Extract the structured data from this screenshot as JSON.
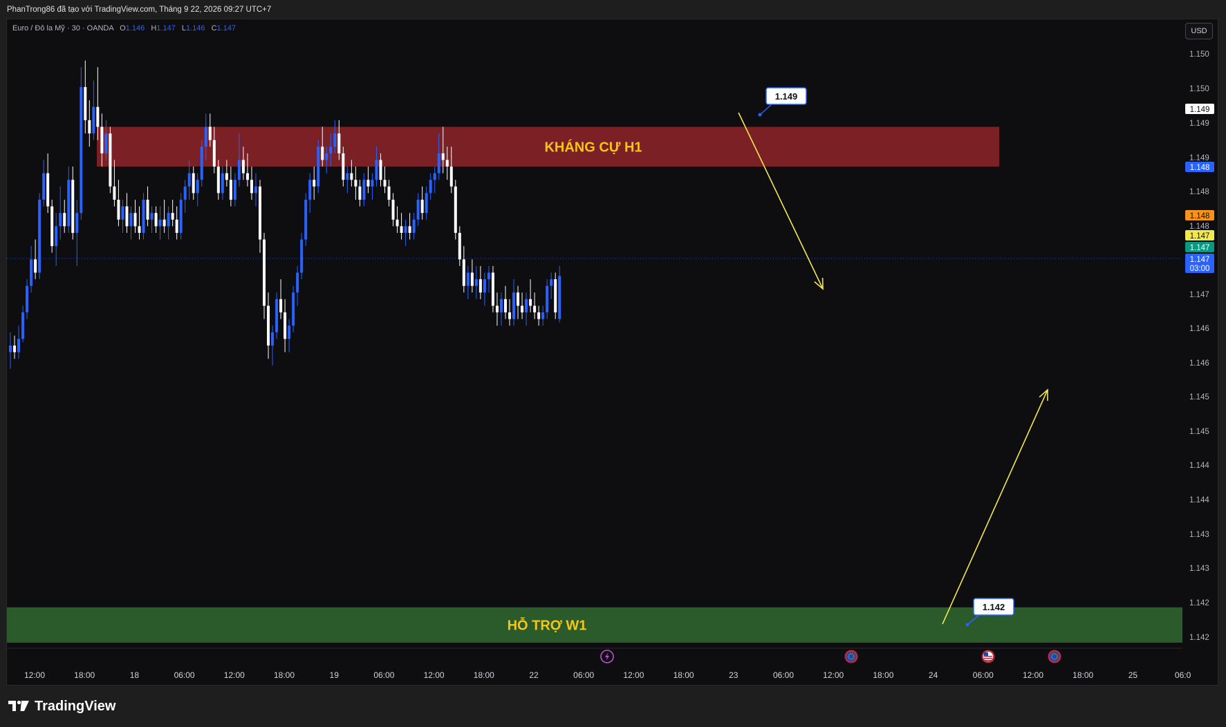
{
  "header": {
    "attribution": "PhanTrong86 đã tạo với TradingView.com, Tháng 9 22, 2026 09:27 UTC+7"
  },
  "legend": {
    "symbol": "Euro / Đô la Mỹ · 30 · OANDA",
    "open_label": "O",
    "open": "1.146",
    "high_label": "H",
    "high": "1.147",
    "low_label": "L",
    "low": "1.146",
    "close_label": "C",
    "close": "1.147"
  },
  "currency_button": "USD",
  "brand": {
    "name": "TradingView",
    "icon": "tradingview-logo-icon"
  },
  "colors": {
    "background": "#0e0e10",
    "bull_candle": "#2962ff",
    "bear_candle": "#ffffff",
    "resistance_zone": "#7b2126",
    "support_zone": "#2b5b2b",
    "zone_text": "#f5c518",
    "arrow": "#f2e94e",
    "current_price": "#2962ff"
  },
  "chart_data": {
    "type": "candlestick",
    "symbol": "EURUSD",
    "timeframe": "30",
    "y_ticks": [
      "1.150",
      "1.150",
      "1.149",
      "1.149",
      "1.148",
      "1.148",
      "1.147",
      "1.147",
      "1.146",
      "1.146",
      "1.145",
      "1.145",
      "1.144",
      "1.144",
      "1.143",
      "1.143",
      "1.142",
      "1.142"
    ],
    "x_ticks": [
      "12:00",
      "18:00",
      "18",
      "06:00",
      "12:00",
      "18:00",
      "19",
      "06:00",
      "12:00",
      "18:00",
      "22",
      "06:00",
      "12:00",
      "18:00",
      "23",
      "06:00",
      "12:00",
      "18:00",
      "24",
      "06:00",
      "12:00",
      "18:00",
      "25",
      "06:0"
    ],
    "ylim": [
      1.1418,
      1.1506
    ],
    "zones": [
      {
        "name": "KHÁNG CỰ H1",
        "from": 1.1489,
        "to": 1.1495,
        "price_label": "1.149"
      },
      {
        "name": "HỖ TRỢ W1",
        "from": 1.1418,
        "to": 1.14225,
        "price_label": "1.142"
      }
    ],
    "price_labels": [
      {
        "text": "1.149",
        "style": "white"
      },
      {
        "text": "1.148",
        "style": "blue"
      },
      {
        "text": "1.148",
        "style": "orange"
      },
      {
        "text": "1.147",
        "style": "yellow"
      },
      {
        "text": "1.147",
        "style": "green"
      },
      {
        "text": "1.147",
        "style": "blue",
        "sub": "03:00"
      }
    ],
    "event_markers": [
      {
        "x_label": "12:00 (22)",
        "icon": "lightning-icon"
      },
      {
        "x_label": "12:00 (23)",
        "icon": "eu-flag-icon"
      },
      {
        "x_label": "06:00 (24)",
        "icon": "us-flag-icon"
      },
      {
        "x_label": "15:00 (24)",
        "icon": "eu-flag-icon"
      }
    ],
    "arrows": [
      {
        "from": {
          "x": "23 03:00",
          "y": 1.14898
        },
        "to": {
          "x": "23 12:00",
          "y": 1.14722
        }
      },
      {
        "from": {
          "x": "24 00:30",
          "y": 1.14227
        },
        "to": {
          "x": "24 18:00",
          "y": 1.1452
        }
      }
    ],
    "candles": [
      [
        1.1461,
        1.1464,
        1.14585,
        1.1462
      ],
      [
        1.1462,
        1.14635,
        1.146,
        1.1461
      ],
      [
        1.1461,
        1.1465,
        1.146,
        1.1463
      ],
      [
        1.1463,
        1.1468,
        1.14625,
        1.1467
      ],
      [
        1.1467,
        1.1472,
        1.1466,
        1.1471
      ],
      [
        1.1471,
        1.1477,
        1.147,
        1.1475
      ],
      [
        1.1475,
        1.1478,
        1.1472,
        1.1473
      ],
      [
        1.1473,
        1.1485,
        1.1472,
        1.1484
      ],
      [
        1.1484,
        1.149,
        1.1483,
        1.1488
      ],
      [
        1.1488,
        1.1491,
        1.1482,
        1.1483
      ],
      [
        1.1483,
        1.1484,
        1.1476,
        1.1477
      ],
      [
        1.1477,
        1.1482,
        1.1474,
        1.148
      ],
      [
        1.148,
        1.1486,
        1.1478,
        1.1482
      ],
      [
        1.1482,
        1.1484,
        1.1479,
        1.148
      ],
      [
        1.148,
        1.1489,
        1.1479,
        1.1487
      ],
      [
        1.1487,
        1.1489,
        1.1478,
        1.1479
      ],
      [
        1.1479,
        1.1484,
        1.1474,
        1.1482
      ],
      [
        1.1482,
        1.1504,
        1.1481,
        1.1501
      ],
      [
        1.1501,
        1.1505,
        1.1494,
        1.1496
      ],
      [
        1.1496,
        1.1499,
        1.1492,
        1.1494
      ],
      [
        1.1494,
        1.1502,
        1.1493,
        1.1498
      ],
      [
        1.1498,
        1.1504,
        1.1493,
        1.1495
      ],
      [
        1.1495,
        1.1497,
        1.1489,
        1.1491
      ],
      [
        1.1491,
        1.1496,
        1.149,
        1.1494
      ],
      [
        1.1494,
        1.1495,
        1.1485,
        1.1486
      ],
      [
        1.1486,
        1.149,
        1.1483,
        1.1484
      ],
      [
        1.1484,
        1.1487,
        1.148,
        1.1481
      ],
      [
        1.1481,
        1.1484,
        1.1479,
        1.1483
      ],
      [
        1.1483,
        1.1485,
        1.1479,
        1.148
      ],
      [
        1.148,
        1.1483,
        1.1478,
        1.1482
      ],
      [
        1.1482,
        1.1484,
        1.1479,
        1.148
      ],
      [
        1.148,
        1.1483,
        1.1478,
        1.1479
      ],
      [
        1.1479,
        1.1485,
        1.1478,
        1.1484
      ],
      [
        1.1484,
        1.1486,
        1.148,
        1.1481
      ],
      [
        1.1481,
        1.1483,
        1.1479,
        1.1482
      ],
      [
        1.1482,
        1.1483,
        1.1479,
        1.148
      ],
      [
        1.148,
        1.1483,
        1.1478,
        1.1481
      ],
      [
        1.1481,
        1.1484,
        1.1479,
        1.148
      ],
      [
        1.148,
        1.1483,
        1.1478,
        1.1482
      ],
      [
        1.1482,
        1.1484,
        1.148,
        1.1481
      ],
      [
        1.1481,
        1.1483,
        1.1478,
        1.1479
      ],
      [
        1.1479,
        1.1485,
        1.1478,
        1.1484
      ],
      [
        1.1484,
        1.1487,
        1.1482,
        1.1486
      ],
      [
        1.1486,
        1.149,
        1.1484,
        1.1488
      ],
      [
        1.1488,
        1.1489,
        1.1484,
        1.1485
      ],
      [
        1.1485,
        1.1488,
        1.1483,
        1.1487
      ],
      [
        1.1487,
        1.1493,
        1.1486,
        1.1492
      ],
      [
        1.1492,
        1.1497,
        1.149,
        1.1495
      ],
      [
        1.1495,
        1.1497,
        1.1492,
        1.1493
      ],
      [
        1.1493,
        1.1495,
        1.1488,
        1.1489
      ],
      [
        1.1489,
        1.149,
        1.1484,
        1.1485
      ],
      [
        1.1485,
        1.1489,
        1.1484,
        1.1488
      ],
      [
        1.1488,
        1.149,
        1.1486,
        1.1487
      ],
      [
        1.1487,
        1.1489,
        1.1483,
        1.1484
      ],
      [
        1.1484,
        1.1488,
        1.1483,
        1.1487
      ],
      [
        1.1487,
        1.1494,
        1.1486,
        1.149
      ],
      [
        1.149,
        1.1492,
        1.1487,
        1.1488
      ],
      [
        1.1488,
        1.1491,
        1.1486,
        1.1487
      ],
      [
        1.1487,
        1.1489,
        1.1484,
        1.1485
      ],
      [
        1.1485,
        1.1488,
        1.1483,
        1.1486
      ],
      [
        1.1486,
        1.1487,
        1.1476,
        1.1478
      ],
      [
        1.1478,
        1.1479,
        1.1466,
        1.1468
      ],
      [
        1.1468,
        1.147,
        1.146,
        1.1462
      ],
      [
        1.1462,
        1.1465,
        1.1459,
        1.1464
      ],
      [
        1.1464,
        1.147,
        1.1463,
        1.1469
      ],
      [
        1.1469,
        1.1472,
        1.1466,
        1.1467
      ],
      [
        1.1467,
        1.1469,
        1.1461,
        1.1463
      ],
      [
        1.1463,
        1.1466,
        1.1461,
        1.1465
      ],
      [
        1.1465,
        1.1471,
        1.1464,
        1.147
      ],
      [
        1.147,
        1.1474,
        1.1468,
        1.1473
      ],
      [
        1.1473,
        1.1479,
        1.1472,
        1.1478
      ],
      [
        1.1478,
        1.1485,
        1.1477,
        1.1484
      ],
      [
        1.1484,
        1.1488,
        1.1482,
        1.1487
      ],
      [
        1.1487,
        1.1489,
        1.1484,
        1.1486
      ],
      [
        1.1486,
        1.1493,
        1.1485,
        1.1492
      ],
      [
        1.1492,
        1.1495,
        1.1489,
        1.149
      ],
      [
        1.149,
        1.1492,
        1.1488,
        1.1491
      ],
      [
        1.1491,
        1.1494,
        1.1489,
        1.1492
      ],
      [
        1.1492,
        1.1496,
        1.1491,
        1.1494
      ],
      [
        1.1494,
        1.1496,
        1.149,
        1.1491
      ],
      [
        1.1491,
        1.1492,
        1.1486,
        1.1487
      ],
      [
        1.1487,
        1.1489,
        1.1485,
        1.1488
      ],
      [
        1.1488,
        1.149,
        1.1486,
        1.1487
      ],
      [
        1.1487,
        1.1489,
        1.1484,
        1.1486
      ],
      [
        1.1486,
        1.1487,
        1.1483,
        1.1484
      ],
      [
        1.1484,
        1.1488,
        1.1483,
        1.1487
      ],
      [
        1.1487,
        1.1489,
        1.1485,
        1.1486
      ],
      [
        1.1486,
        1.1488,
        1.1484,
        1.1487
      ],
      [
        1.1487,
        1.1492,
        1.1486,
        1.149
      ],
      [
        1.149,
        1.1491,
        1.1486,
        1.1487
      ],
      [
        1.1487,
        1.1489,
        1.1485,
        1.1486
      ],
      [
        1.1486,
        1.1487,
        1.1483,
        1.1484
      ],
      [
        1.1484,
        1.1485,
        1.148,
        1.1481
      ],
      [
        1.1481,
        1.1483,
        1.1479,
        1.148
      ],
      [
        1.148,
        1.1482,
        1.1478,
        1.1479
      ],
      [
        1.1479,
        1.1481,
        1.1477,
        1.148
      ],
      [
        1.148,
        1.1482,
        1.1478,
        1.1479
      ],
      [
        1.1479,
        1.1482,
        1.1478,
        1.1481
      ],
      [
        1.1481,
        1.1485,
        1.148,
        1.1484
      ],
      [
        1.1484,
        1.1486,
        1.1481,
        1.1482
      ],
      [
        1.1482,
        1.1486,
        1.1481,
        1.1485
      ],
      [
        1.1485,
        1.1488,
        1.1484,
        1.1487
      ],
      [
        1.1487,
        1.1489,
        1.1485,
        1.1488
      ],
      [
        1.1488,
        1.1494,
        1.1487,
        1.1491
      ],
      [
        1.1491,
        1.1495,
        1.1488,
        1.149
      ],
      [
        1.149,
        1.1492,
        1.1487,
        1.1489
      ],
      [
        1.1489,
        1.1492,
        1.1485,
        1.1486
      ],
      [
        1.1486,
        1.1487,
        1.1478,
        1.1479
      ],
      [
        1.1479,
        1.148,
        1.1474,
        1.1475
      ],
      [
        1.1475,
        1.1477,
        1.147,
        1.1471
      ],
      [
        1.1471,
        1.1474,
        1.1469,
        1.1473
      ],
      [
        1.1473,
        1.1475,
        1.147,
        1.1471
      ],
      [
        1.1471,
        1.1474,
        1.1469,
        1.1472
      ],
      [
        1.1472,
        1.1474,
        1.1469,
        1.147
      ],
      [
        1.147,
        1.1473,
        1.1468,
        1.1472
      ],
      [
        1.1472,
        1.1474,
        1.147,
        1.1473
      ],
      [
        1.1473,
        1.1474,
        1.1467,
        1.1468
      ],
      [
        1.1468,
        1.147,
        1.1465,
        1.1467
      ],
      [
        1.1467,
        1.147,
        1.1465,
        1.1469
      ],
      [
        1.1469,
        1.1471,
        1.1466,
        1.1467
      ],
      [
        1.1467,
        1.1469,
        1.1465,
        1.1466
      ],
      [
        1.1466,
        1.1472,
        1.1465,
        1.147
      ],
      [
        1.147,
        1.1471,
        1.1466,
        1.1468
      ],
      [
        1.1468,
        1.147,
        1.1466,
        1.1467
      ],
      [
        1.1467,
        1.147,
        1.1465,
        1.1469
      ],
      [
        1.1469,
        1.1472,
        1.1467,
        1.1468
      ],
      [
        1.1468,
        1.147,
        1.1466,
        1.1467
      ],
      [
        1.1467,
        1.1468,
        1.1465,
        1.1466
      ],
      [
        1.1466,
        1.1468,
        1.1465,
        1.1467
      ],
      [
        1.1467,
        1.1472,
        1.1466,
        1.1471
      ],
      [
        1.1471,
        1.1473,
        1.1469,
        1.1472
      ],
      [
        1.1472,
        1.1473,
        1.1466,
        1.1467
      ],
      [
        1.1466,
        1.1474,
        1.14655,
        1.14725
      ]
    ]
  }
}
